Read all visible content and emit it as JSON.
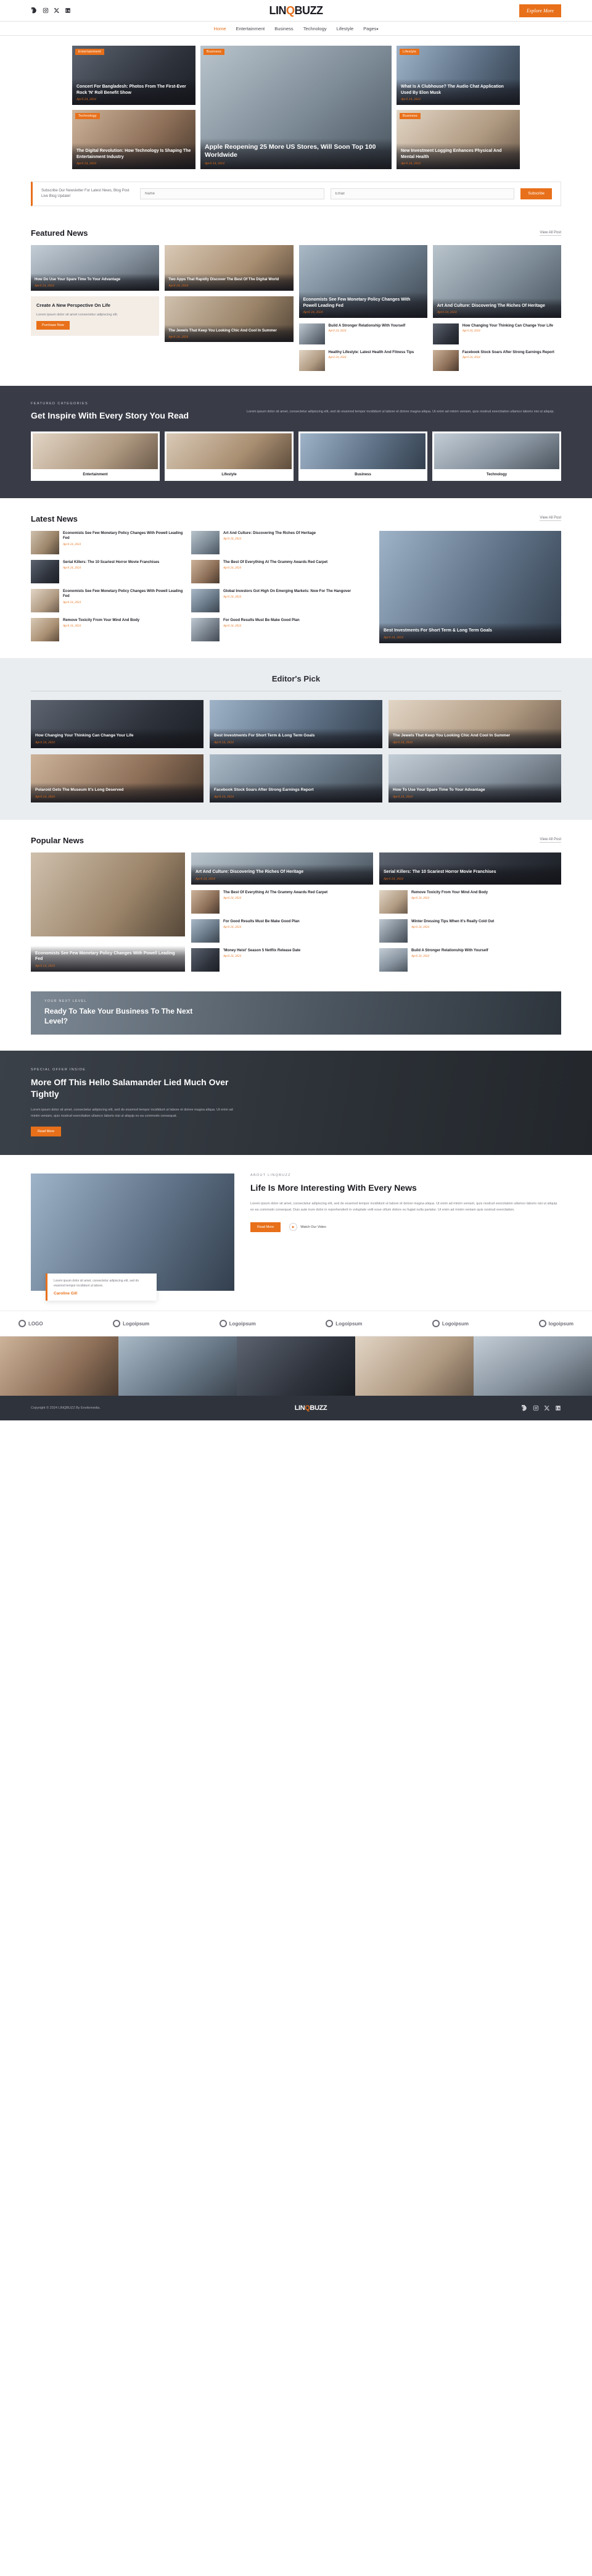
{
  "site": {
    "brand_pre": "LIN",
    "brand_mark": "Q",
    "brand_post": "BUZZ"
  },
  "topbar": {
    "social": [
      "facebook-icon",
      "instagram-icon",
      "x-icon",
      "linkedin-icon"
    ],
    "explore_label": "Explore More"
  },
  "nav": {
    "items": [
      {
        "label": "Home",
        "active": true,
        "caret": ""
      },
      {
        "label": "Entertainment",
        "active": false,
        "caret": ""
      },
      {
        "label": "Business",
        "active": false,
        "caret": ""
      },
      {
        "label": "Technology",
        "active": false,
        "caret": ""
      },
      {
        "label": "Lifestyle",
        "active": false,
        "caret": ""
      },
      {
        "label": "Pages",
        "active": false,
        "caret": "▾"
      }
    ]
  },
  "hero": {
    "left": [
      {
        "tag": "Entertainment",
        "title": "Concert For Bangladesh: Photos From The First-Ever Rock 'N' Roll Benefit Show",
        "date": "April 24, 2024"
      },
      {
        "tag": "Technology",
        "title": "The Digital Revolution: How Technology Is Shaping The Entertainment Industry",
        "date": "April 24, 2024"
      }
    ],
    "main": {
      "tag": "Business",
      "title": "Apple Reopening 25 More US Stores, Will Soon Top 100 Worldwide",
      "date": "April 24, 2024"
    },
    "right": [
      {
        "tag": "Lifestyle",
        "title": "What Is A Clubhouse? The Audio Chat Application Used By Elon Musk",
        "date": "April 24, 2024"
      },
      {
        "tag": "Business",
        "title": "New Investment Logging Enhances Physical And Mental Health",
        "date": "April 24, 2024"
      }
    ]
  },
  "subscribe": {
    "text": "Subscribe Our Newsletter For Latest News, Blog Post Live Blog Update!",
    "name_placeholder": "Name",
    "email_placeholder": "Email",
    "button_label": "Subscribe"
  },
  "featured": {
    "heading": "Featured News",
    "view_all": "View All Post",
    "col1": [
      {
        "title": "How Do Use Your Spare Time To Your Advantage",
        "date": "April 24, 2024"
      },
      {
        "title": "Create A New Perspective On Life",
        "body": "Lorem ipsum dolor sit amet consectetur adipiscing elit.",
        "button": "Purchase Now"
      }
    ],
    "col2": [
      {
        "title": "Two Apps That Rapidly Discover The Best Of The Digital World",
        "date": "April 24, 2024"
      },
      {
        "title": "The Jewels That Keep You Looking Chic And Cool In Summer",
        "date": "April 24, 2024"
      }
    ],
    "col3_big": {
      "title": "Economists See Few Monetary Policy Changes With Powell Leading Fed",
      "date": "April 24, 2024"
    },
    "col3_list": [
      {
        "title": "Build A Stronger Relationship With Yourself",
        "date": "April 24, 2024"
      },
      {
        "title": "Healthy Lifestyle: Latest Health And Fitness Tips",
        "date": "April 24, 2024"
      }
    ],
    "col4_big": {
      "title": "Art And Culture: Discovering The Riches Of Heritage",
      "date": "April 24, 2024"
    },
    "col4_list": [
      {
        "title": "How Changing Your Thinking Can Change Your Life",
        "date": "April 24, 2024"
      },
      {
        "title": "Facebook Stock Soars After Strong Earnings Report",
        "date": "April 24, 2024"
      }
    ]
  },
  "inspire": {
    "kicker": "FEATURED CATEGORIES",
    "heading": "Get Inspire With Every Story You Read",
    "body": "Lorem ipsum dolor sit amet, consectetur adipiscing elit, sed do eiusmod tempor incididunt ut labore et dolore magna aliqua. Ut enim ad minim veniam, quis nostrud exercitation ullamco laboris nisi ut aliquip.",
    "categories": [
      {
        "label": "Entertainment"
      },
      {
        "label": "Lifestyle"
      },
      {
        "label": "Business"
      },
      {
        "label": "Technology"
      }
    ]
  },
  "latest": {
    "heading": "Latest News",
    "view_all": "View All Post",
    "list": [
      {
        "title": "Economists See Few Monetary Policy Changes With Powell Leading Fed",
        "date": "April 24, 2024"
      },
      {
        "title": "Serial Killers: The 10 Scariest Horror Movie Franchises",
        "date": "April 24, 2024"
      },
      {
        "title": "Economists See Few Monetary Policy Changes With Powell Leading Fed",
        "date": "April 24, 2024"
      },
      {
        "title": "Remove Toxicity From Your Mind And Body",
        "date": "April 24, 2024"
      }
    ],
    "right": [
      {
        "title": "Art And Culture: Discovering The Riches Of Heritage",
        "date": "April 24, 2024"
      },
      {
        "title": "The Best Of Everything At The Grammy Awards Red Carpet",
        "date": "April 24, 2024"
      },
      {
        "title": "Global Investors Got High On Emerging Markets: Now For The Hangover",
        "date": "April 24, 2024"
      },
      {
        "title": "For Good Results Must Be Make Good Plan",
        "date": "April 24, 2024"
      }
    ],
    "feature": {
      "title": "Best Investments For Short Term & Long Term Goals",
      "date": "April 24, 2024"
    }
  },
  "editors": {
    "heading": "Editor's Pick",
    "cards": [
      {
        "title": "How Changing Your Thinking Can Change Your Life",
        "date": "April 24, 2024"
      },
      {
        "title": "Best Investments For Short Term & Long Term Goals",
        "date": "April 24, 2024"
      },
      {
        "title": "The Jewels That Keep You Looking Chic And Cool In Summer",
        "date": "April 24, 2024"
      },
      {
        "title": "Polaroid Gets The Museum It's Long Deserved",
        "date": "April 24, 2024"
      },
      {
        "title": "Facebook Stock Soars After Strong Earnings Report",
        "date": "April 24, 2024"
      },
      {
        "title": "How To Use Your Spare Time To Your Advantage",
        "date": "April 24, 2024"
      }
    ]
  },
  "popular": {
    "heading": "Popular News",
    "view_all": "View All Post",
    "big": {
      "title": "Economists See Few Monetary Policy Changes With Powell Leading Fed",
      "date": "April 24, 2024"
    },
    "top_cards": [
      {
        "title": "Art And Culture: Discovering The Riches Of Heritage",
        "date": "April 24, 2024"
      },
      {
        "title": "Serial Killers: The 10 Scariest Horror Movie Franchises",
        "date": "April 24, 2024"
      }
    ],
    "list_left": [
      {
        "title": "The Best Of Everything At The Grammy Awards Red Carpet",
        "date": "April 24, 2024"
      },
      {
        "title": "For Good Results Must Be Make Good Plan",
        "date": "April 24, 2024"
      },
      {
        "title": "'Money Heist' Season 5 Netflix Release Date",
        "date": "April 24, 2024"
      }
    ],
    "list_right": [
      {
        "title": "Remove Toxicity From Your Mind And Body",
        "date": "April 24, 2024"
      },
      {
        "title": "Winter Dressing Tips When It's Really Cold Out",
        "date": "April 24, 2024"
      },
      {
        "title": "Build A Stronger Relationship With Yourself",
        "date": "April 24, 2024"
      }
    ]
  },
  "cta": {
    "kicker": "YOUR NEXT LEVEL",
    "heading": "Ready To Take Your Business To The Next Level?"
  },
  "special": {
    "kicker": "SPECIAL OFFER INSIDE",
    "heading": "More Off This Hello Salamander Lied Much Over Tightly",
    "body": "Lorem ipsum dolor sit amet, consectetur adipiscing elit, sed do eiusmod tempor incididunt ut labore et dolore magna aliqua. Ut enim ad minim veniam, quis nostrud exercitation ullamco laboris nisi ut aliquip ex ea commodo consequat.",
    "button": "Read More"
  },
  "about": {
    "kicker": "ABOUT LINQBUZZ",
    "heading": "Life Is More Interesting With Every News",
    "body": "Lorem ipsum dolor sit amet, consectetur adipiscing elit, sed do eiusmod tempor incididunt ut labore et dolore magna aliqua. Ut enim ad minim veniam, quis nostrud exercitation ullamco laboris nisi ut aliquip ex ea commodo consequat. Duis aute irure dolor in reprehenderit in voluptate velit esse cillum dolore eu fugiat nulla pariatur. Ut enim ad minim veniam quis nostrud exercitation.",
    "button": "Read More",
    "watch_label": "Watch Our Video",
    "quote_text": "Lorem ipsum dolor sit amet, consectetur adipiscing elit, sed do eiusmod tempor incididunt ut labore.",
    "quote_name": "Caroline Gill"
  },
  "logos": [
    {
      "label": "LOGO",
      "mark": "logo-mark"
    },
    {
      "label": "Logoipsum",
      "mark": "logo-mark"
    },
    {
      "label": "Logoipsum",
      "mark": "logo-mark"
    },
    {
      "label": "Logoipsum",
      "mark": "logo-mark"
    },
    {
      "label": "Logoipsum",
      "mark": "logo-mark"
    },
    {
      "label": "logoipsum",
      "mark": "logo-mark"
    }
  ],
  "footer": {
    "copyright": "Copyright © 2024 LINQBUZZ By Envitomedia.",
    "social": [
      "facebook-icon",
      "instagram-icon",
      "x-icon",
      "linkedin-icon"
    ]
  }
}
